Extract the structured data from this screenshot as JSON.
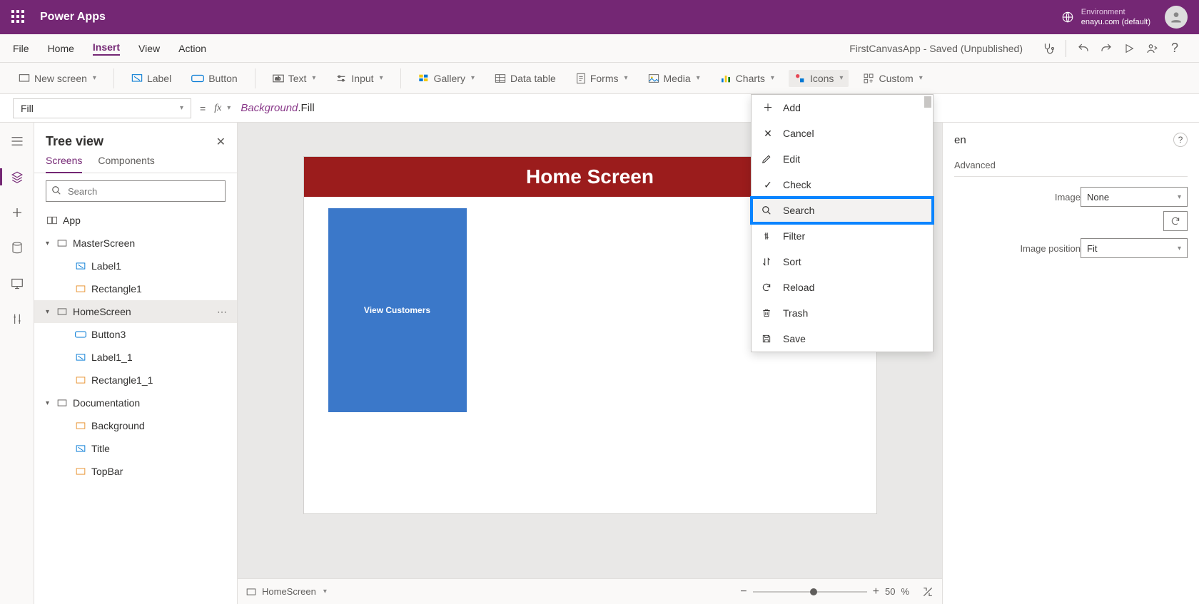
{
  "titlebar": {
    "app": "Power Apps",
    "env_label": "Environment",
    "env_value": "enayu.com (default)"
  },
  "menu": {
    "items": [
      "File",
      "Home",
      "Insert",
      "View",
      "Action"
    ],
    "active": "Insert",
    "doc_status": "FirstCanvasApp - Saved (Unpublished)"
  },
  "ribbon": {
    "new_screen": "New screen",
    "label": "Label",
    "button": "Button",
    "text": "Text",
    "input": "Input",
    "gallery": "Gallery",
    "data_table": "Data table",
    "forms": "Forms",
    "media": "Media",
    "charts": "Charts",
    "icons": "Icons",
    "custom": "Custom"
  },
  "formula": {
    "property": "Fill",
    "ref": "Background",
    "member": ".Fill"
  },
  "tree": {
    "title": "Tree view",
    "tabs": [
      "Screens",
      "Components"
    ],
    "search_placeholder": "Search",
    "app": "App",
    "nodes": {
      "master": "MasterScreen",
      "label1": "Label1",
      "rect1": "Rectangle1",
      "home": "HomeScreen",
      "btn3": "Button3",
      "label11": "Label1_1",
      "rect11": "Rectangle1_1",
      "doc": "Documentation",
      "bg": "Background",
      "titleN": "Title",
      "tb": "TopBar"
    }
  },
  "canvas": {
    "header": "Home Screen",
    "button": "View Customers"
  },
  "footer": {
    "screen": "HomeScreen",
    "zoom": "50",
    "zoom_unit": "%"
  },
  "props": {
    "panel_suffix": "en",
    "tab_adv": "Advanced",
    "image_lbl": "Image",
    "image_val": "None",
    "pos_lbl": "Image position",
    "pos_val": "Fit"
  },
  "icons_menu": [
    "Add",
    "Cancel",
    "Edit",
    "Check",
    "Search",
    "Filter",
    "Sort",
    "Reload",
    "Trash",
    "Save"
  ]
}
